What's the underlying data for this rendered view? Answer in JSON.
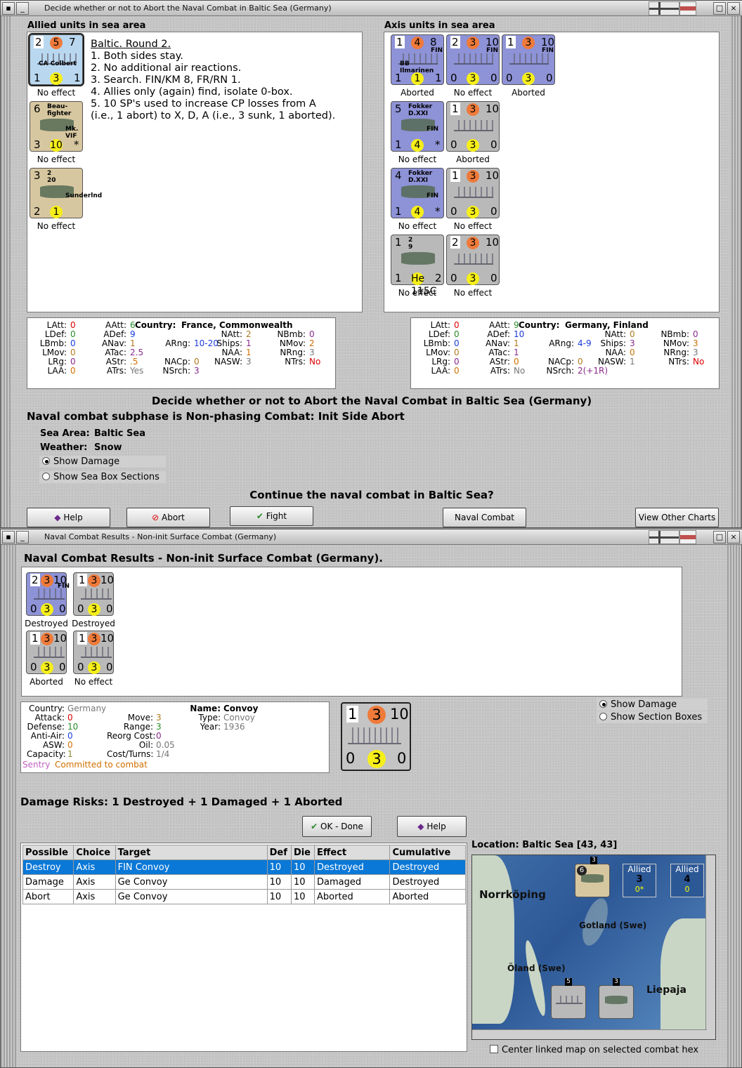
{
  "top": {
    "title": "Decide whether or not to Abort the Naval Combat in Baltic Sea (Germany)",
    "allied_header": "Allied units in sea area",
    "axis_header": "Axis units in sea area",
    "notes": [
      "Baltic.  Round 2.",
      "1.  Both sides stay.",
      "2.  No additional air reactions.",
      "3.  Search.  FIN/KM 8, FR/RN 1.",
      "4.  Allies only (again) find, isolate 0-box.",
      "5.  10 SP's used to increase CP losses from A",
      "(i.e., 1 abort) to X, D, A (i.e., 3 sunk, 1 aborted)."
    ],
    "allied_units": [
      {
        "a": "2",
        "b": "5",
        "c": "7",
        "d": "1",
        "e": "3",
        "f": "1",
        "name": "CA Colbert",
        "caption": "No effect"
      },
      {
        "a": "6",
        "b": "Beau-",
        "c": "fighter",
        "d": "3",
        "e": "10",
        "f": "*",
        "name": "Mk. VIF",
        "caption": "No effect"
      },
      {
        "a": "3",
        "b": "2",
        "c": "20",
        "d": "2",
        "e": "1",
        "f": "",
        "name": "Sunderlnd",
        "caption": "No effect"
      }
    ],
    "axis_units": [
      {
        "a": "1",
        "b": "4",
        "c": "8",
        "d": "1",
        "e": "1",
        "f": "1",
        "name": "BB Ilmarinen",
        "tag": "FIN",
        "caption": "Aborted"
      },
      {
        "a": "2",
        "b": "3",
        "c": "10",
        "d": "0",
        "e": "3",
        "f": "0",
        "name": "",
        "tag": "FIN",
        "caption": "No effect"
      },
      {
        "a": "1",
        "b": "3",
        "c": "10",
        "d": "0",
        "e": "3",
        "f": "0",
        "name": "",
        "tag": "FIN",
        "caption": "Aborted"
      },
      {
        "a": "5",
        "b": "Fokker",
        "c": "D.XXI",
        "d": "1",
        "e": "4",
        "f": "*",
        "name": "FIN",
        "tag": "",
        "caption": "No effect"
      },
      {
        "a": "1",
        "b": "3",
        "c": "10",
        "d": "0",
        "e": "3",
        "f": "0",
        "name": "",
        "tag": "",
        "caption": "Aborted"
      },
      {
        "a": "4",
        "b": "Fokker",
        "c": "D.XXI",
        "d": "1",
        "e": "4",
        "f": "*",
        "name": "FIN",
        "tag": "",
        "caption": "No effect"
      },
      {
        "a": "1",
        "b": "3",
        "c": "10",
        "d": "0",
        "e": "3",
        "f": "0",
        "name": "",
        "tag": "",
        "caption": "No effect"
      },
      {
        "a": "1",
        "b": "2",
        "c": "9",
        "d": "1",
        "e": "He 115C",
        "f": "2",
        "name": "",
        "tag": "",
        "caption": "No effect"
      },
      {
        "a": "2",
        "b": "3",
        "c": "10",
        "d": "0",
        "e": "3",
        "f": "0",
        "name": "",
        "tag": "",
        "caption": "No effect"
      }
    ],
    "allied_stats": {
      "country_label": "Country:",
      "country": "France, Commonwealth",
      "col1": [
        [
          "LAtt:",
          "0"
        ],
        [
          "LDef:",
          "0"
        ],
        [
          "LBmb:",
          "0"
        ],
        [
          "LMov:",
          "0"
        ],
        [
          "LRg:",
          "0"
        ],
        [
          "LAA:",
          "0"
        ]
      ],
      "col2": [
        [
          "AAtt:",
          "6"
        ],
        [
          "ADef:",
          "9"
        ],
        [
          "ANav:",
          "1"
        ],
        [
          "ATac:",
          "2.5"
        ],
        [
          "AStr:",
          ".5"
        ],
        [
          "ATrs:",
          "Yes"
        ]
      ],
      "col3": [
        [
          "ARng:",
          "10-20"
        ],
        [
          "NACp:",
          "0"
        ],
        [
          "NSrch:",
          "3"
        ]
      ],
      "col4": [
        [
          "NAtt:",
          "2"
        ],
        [
          "Ships:",
          "1"
        ],
        [
          "NAA:",
          "1"
        ],
        [
          "NASW:",
          "3"
        ]
      ],
      "col5": [
        [
          "NBmb:",
          "0"
        ],
        [
          "NMov:",
          "2"
        ],
        [
          "NRng:",
          "3"
        ],
        [
          "NTrs:",
          "No"
        ]
      ]
    },
    "axis_stats": {
      "country_label": "Country:",
      "country": "Germany, Finland",
      "col1": [
        [
          "LAtt:",
          "0"
        ],
        [
          "LDef:",
          "0"
        ],
        [
          "LBmb:",
          "0"
        ],
        [
          "LMov:",
          "0"
        ],
        [
          "LRg:",
          "0"
        ],
        [
          "LAA:",
          "0"
        ]
      ],
      "col2": [
        [
          "AAtt:",
          "9"
        ],
        [
          "ADef:",
          "10"
        ],
        [
          "ANav:",
          "1"
        ],
        [
          "ATac:",
          "1"
        ],
        [
          "AStr:",
          "0"
        ],
        [
          "ATrs:",
          "No"
        ]
      ],
      "col3": [
        [
          "ARng:",
          "4-9"
        ],
        [
          "NACp:",
          "0"
        ],
        [
          "NSrch:",
          "2(+1R)"
        ]
      ],
      "col4": [
        [
          "NAtt:",
          "0"
        ],
        [
          "Ships:",
          "3"
        ],
        [
          "NAA:",
          "0"
        ],
        [
          "NASW:",
          "1"
        ]
      ],
      "col5": [
        [
          "NBmb:",
          "0"
        ],
        [
          "NMov:",
          "3"
        ],
        [
          "NRng:",
          "3"
        ],
        [
          "NTrs:",
          "No"
        ]
      ]
    },
    "decide_title": "Decide whether or not to Abort the Naval Combat in Baltic Sea (Germany)",
    "subphase": "Naval combat subphase is Non-phasing Combat: Init Side Abort",
    "sea_area_label": "Sea Area:",
    "sea_area": "Baltic Sea",
    "weather_label": "Weather:",
    "weather": "Snow",
    "radio_damage": "Show Damage",
    "radio_sections": "Show Sea Box Sections",
    "question": "Continue the naval combat in Baltic Sea?",
    "buttons": {
      "help": "Help",
      "abort": "Abort",
      "fight": "Fight",
      "chart": "Naval Combat Chart",
      "other": "View Other Charts"
    }
  },
  "bottom": {
    "title": "Naval Combat Results - Non-init Surface Combat (Germany)",
    "header": "Naval Combat Results - Non-init Surface Combat (Germany).",
    "units": [
      {
        "a": "2",
        "b": "3",
        "c": "10",
        "d": "0",
        "e": "3",
        "f": "0",
        "tag": "FIN",
        "caption": "Destroyed"
      },
      {
        "a": "1",
        "b": "3",
        "c": "10",
        "d": "0",
        "e": "3",
        "f": "0",
        "tag": "",
        "caption": "Destroyed"
      },
      {
        "a": "1",
        "b": "3",
        "c": "10",
        "d": "0",
        "e": "3",
        "f": "0",
        "tag": "",
        "caption": "Aborted"
      },
      {
        "a": "1",
        "b": "3",
        "c": "10",
        "d": "0",
        "e": "3",
        "f": "0",
        "tag": "",
        "caption": "No effect"
      }
    ],
    "info": {
      "country_label": "Country:",
      "country": "Germany",
      "attack_label": "Attack:",
      "attack": "0",
      "defense_label": "Defense:",
      "defense": "10",
      "aa_label": "Anti-Air:",
      "aa": "0",
      "asw_label": "ASW:",
      "asw": "0",
      "cap_label": "Capacity:",
      "cap": "1",
      "move_label": "Move:",
      "move": "3",
      "range_label": "Range:",
      "range": "3",
      "reorg_label": "Reorg Cost:",
      "reorg": "0",
      "oil_label": "Oil:",
      "oil": "0.05",
      "cost_label": "Cost/Turns:",
      "cost": "1/4",
      "name_label": "Name:",
      "name": "Convoy",
      "type_label": "Type:",
      "type": "Convoy",
      "year_label": "Year:",
      "year": "1936",
      "sentry": "Sentry",
      "committed": "Committed to combat"
    },
    "big_unit": {
      "a": "1",
      "b": "3",
      "c": "10",
      "d": "0",
      "e": "3",
      "f": "0"
    },
    "radio_damage": "Show Damage",
    "radio_sections": "Show Section Boxes",
    "risks": "Damage Risks:  1 Destroyed + 1 Damaged + 1 Aborted",
    "ok": "OK - Done",
    "help": "Help",
    "table": {
      "headers": [
        "Possible",
        "Choice",
        "Target",
        "Def",
        "Die",
        "Effect",
        "Cumulative"
      ],
      "rows": [
        [
          "Destroy",
          "Axis",
          "FIN Convoy",
          "10",
          "10",
          "Destroyed",
          "Destroyed"
        ],
        [
          "Damage",
          "Axis",
          "Ge Convoy",
          "10",
          "10",
          "Damaged",
          "Destroyed"
        ],
        [
          "Abort",
          "Axis",
          "Ge Convoy",
          "10",
          "10",
          "Aborted",
          "Aborted"
        ]
      ]
    },
    "location": "Location:  Baltic Sea [43, 43]",
    "map": {
      "labels": [
        "Norrköping",
        "Gotland (Swe)",
        "Öland (Swe)",
        "Liepaja"
      ],
      "allied1": {
        "name": "Allied",
        "n": "3",
        "sub": "0*"
      },
      "allied2": {
        "name": "Allied",
        "n": "4",
        "sub": "0"
      },
      "stack_counts": [
        "3",
        "5",
        "3"
      ]
    },
    "center_check": "Center linked map on selected combat hex"
  }
}
